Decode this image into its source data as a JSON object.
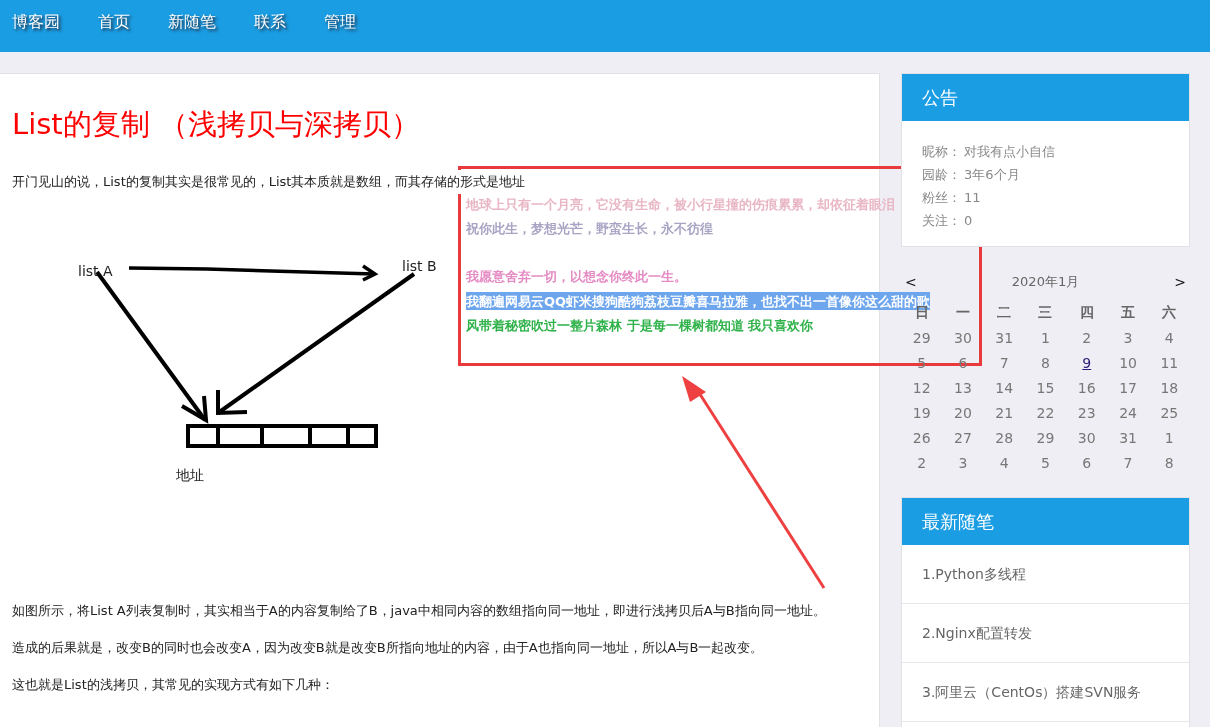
{
  "nav": [
    "博客园",
    "首页",
    "新随笔",
    "联系",
    "管理"
  ],
  "article": {
    "title": "List的复制 （浅拷贝与深拷贝）",
    "intro": "开门见山的说，List的复制其实是很常见的，List其本质就是数组，而其存储的形式是地址",
    "diagram": {
      "label_a": "list A",
      "label_b": "list B",
      "label_address": "地址"
    },
    "paragraphs": [
      " 如图所示，将List A列表复制时，其实相当于A的内容复制给了B，java中相同内容的数组指向同一地址，即进行浅拷贝后A与B指向同一地址。",
      "造成的后果就是，改变B的同时也会改变A，因为改变B就是改变B所指向地址的内容，由于A也指向同一地址，所以A与B一起改变。",
      "这也就是List的浅拷贝，其常见的实现方式有如下几种："
    ]
  },
  "floating_lines": [
    {
      "text": "地球上只有一个月亮，它没有生命，被小行星撞的伤痕累累，却依征着眼泪",
      "color": "#e8b6c4",
      "highlighted": false
    },
    {
      "text": "祝你此生，梦想光芒，野蛮生长，永不彷徨",
      "color": "#a8a4c4",
      "highlighted": false
    },
    {
      "text": "我愿意舍弃一切，以想念你终此一生。",
      "color": "#e58bc4",
      "highlighted": false
    },
    {
      "text": "我翻遍网易云QQ虾米搜狗酷狗荔枝豆瓣喜马拉雅，也找不出一首像你这么甜的歌",
      "highlighted": true
    },
    {
      "text": "风带着秘密吹过一整片森林 于是每一棵树都知道 我只喜欢你",
      "color": "#2fb24a",
      "highlighted": false
    }
  ],
  "notice": {
    "title": "公告",
    "items": [
      {
        "label": "昵称：",
        "value": "对我有点小自信"
      },
      {
        "label": "园龄：",
        "value": "3年6个月"
      },
      {
        "label": "粉丝：",
        "value": "11"
      },
      {
        "label": "关注：",
        "value": "0"
      }
    ]
  },
  "calendar": {
    "prev": "<",
    "month": "2020年1月",
    "next": ">",
    "weekdays": [
      "日",
      "一",
      "二",
      "三",
      "四",
      "五",
      "六"
    ],
    "weeks": [
      [
        {
          "day": "29",
          "today": false
        },
        {
          "day": "30",
          "today": false
        },
        {
          "day": "31",
          "today": false
        },
        {
          "day": "1",
          "today": false
        },
        {
          "day": "2",
          "today": false
        },
        {
          "day": "3",
          "today": false
        },
        {
          "day": "4",
          "today": false
        }
      ],
      [
        {
          "day": "5",
          "today": false
        },
        {
          "day": "6",
          "today": false
        },
        {
          "day": "7",
          "today": false
        },
        {
          "day": "8",
          "today": false
        },
        {
          "day": "9",
          "today": true
        },
        {
          "day": "10",
          "today": false
        },
        {
          "day": "11",
          "today": false
        }
      ],
      [
        {
          "day": "12",
          "today": false
        },
        {
          "day": "13",
          "today": false
        },
        {
          "day": "14",
          "today": false
        },
        {
          "day": "15",
          "today": false
        },
        {
          "day": "16",
          "today": false
        },
        {
          "day": "17",
          "today": false
        },
        {
          "day": "18",
          "today": false
        }
      ],
      [
        {
          "day": "19",
          "today": false
        },
        {
          "day": "20",
          "today": false
        },
        {
          "day": "21",
          "today": false
        },
        {
          "day": "22",
          "today": false
        },
        {
          "day": "23",
          "today": false
        },
        {
          "day": "24",
          "today": false
        },
        {
          "day": "25",
          "today": false
        }
      ],
      [
        {
          "day": "26",
          "today": false
        },
        {
          "day": "27",
          "today": false
        },
        {
          "day": "28",
          "today": false
        },
        {
          "day": "29",
          "today": false
        },
        {
          "day": "30",
          "today": false
        },
        {
          "day": "31",
          "today": false
        },
        {
          "day": "1",
          "today": false
        }
      ],
      [
        {
          "day": "2",
          "today": false
        },
        {
          "day": "3",
          "today": false
        },
        {
          "day": "4",
          "today": false
        },
        {
          "day": "5",
          "today": false
        },
        {
          "day": "6",
          "today": false
        },
        {
          "day": "7",
          "today": false
        },
        {
          "day": "8",
          "today": false
        }
      ]
    ]
  },
  "recent_posts": {
    "title": "最新随笔",
    "items": [
      "1.Python多线程",
      "2.Nginx配置转发",
      "3.阿里云（CentOs）搭建SVN服务"
    ]
  }
}
